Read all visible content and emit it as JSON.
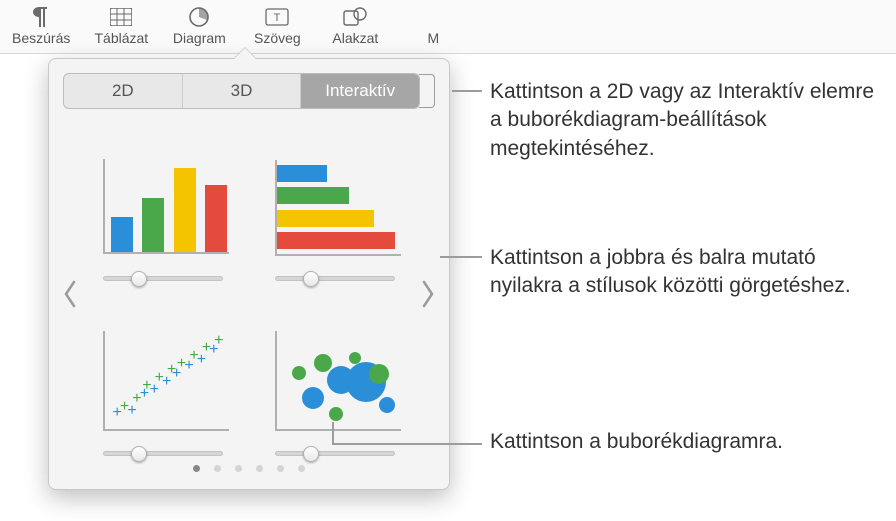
{
  "toolbar": {
    "items": [
      {
        "label": "Beszúrás",
        "icon": "paragraph-icon"
      },
      {
        "label": "Táblázat",
        "icon": "table-icon"
      },
      {
        "label": "Diagram",
        "icon": "pie-icon"
      },
      {
        "label": "Szöveg",
        "icon": "text-icon"
      },
      {
        "label": "Alakzat",
        "icon": "shape-icon"
      },
      {
        "label": "M",
        "icon": "more-icon"
      }
    ]
  },
  "popover": {
    "tabs": {
      "t2d": "2D",
      "t3d": "3D",
      "interactive": "Interaktív"
    }
  },
  "colors": {
    "blue": "#2a8fd8",
    "green": "#4aa84a",
    "yellow": "#f5c400",
    "red": "#e44b3d",
    "teal": "#3bb5a9",
    "cyan": "#4fc4cf"
  },
  "callouts": {
    "c1": "Kattintson a 2D vagy az Interaktív elemre a buborékdiagram-beállítások megtekintéséhez.",
    "c2": "Kattintson a jobbra és balra mutató nyilakra a stílusok közötti görgetéshez.",
    "c3": "Kattintson a buborékdiagramra."
  }
}
